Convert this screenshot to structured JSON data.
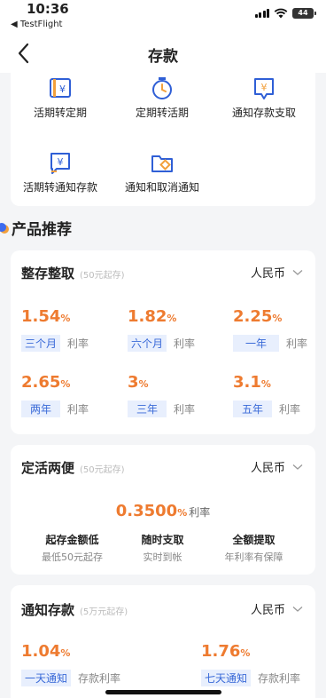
{
  "status_bar": {
    "time": "10:36",
    "back_app": "◀ TestFlight",
    "battery": "44"
  },
  "nav": {
    "title": "存款"
  },
  "services": [
    {
      "label": "活期转定期",
      "icon": "yuan-book-icon"
    },
    {
      "label": "定期转活期",
      "icon": "stopwatch-icon"
    },
    {
      "label": "通知存款支取",
      "icon": "yuan-bubble-icon"
    },
    {
      "label": "活期转通知存款",
      "icon": "yuan-message-icon"
    },
    {
      "label": "通知和取消通知",
      "icon": "folder-icon"
    }
  ],
  "section": {
    "title": "产品推荐"
  },
  "fixed": {
    "title": "整存整取",
    "subtitle": "(50元起存)",
    "currency": "人民币",
    "rates": [
      {
        "value": "1.54",
        "unit": "%",
        "term": "三个月",
        "suffix": "利率"
      },
      {
        "value": "1.82",
        "unit": "%",
        "term": "六个月",
        "suffix": "利率"
      },
      {
        "value": "2.25",
        "unit": "%",
        "term": "一年",
        "suffix": "利率"
      },
      {
        "value": "2.65",
        "unit": "%",
        "term": "两年",
        "suffix": "利率"
      },
      {
        "value": "3",
        "unit": "%",
        "term": "三年",
        "suffix": "利率"
      },
      {
        "value": "3.1",
        "unit": "%",
        "term": "五年",
        "suffix": "利率"
      }
    ]
  },
  "flex": {
    "title": "定活两便",
    "subtitle": "(50元起存)",
    "currency": "人民币",
    "rate_value": "0.3500",
    "rate_unit": "%",
    "rate_label": "利率",
    "features": [
      {
        "title": "起存金额低",
        "desc": "最低50元起存"
      },
      {
        "title": "随时支取",
        "desc": "实时到帐"
      },
      {
        "title": "全额提取",
        "desc": "年利率有保障"
      }
    ]
  },
  "notice": {
    "title": "通知存款",
    "subtitle": "(5万元起存)",
    "currency": "人民币",
    "rates": [
      {
        "value": "1.04",
        "unit": "%",
        "term": "一天通知",
        "suffix": "存款利率"
      },
      {
        "value": "1.76",
        "unit": "%",
        "term": "七天通知",
        "suffix": "存款利率"
      }
    ]
  },
  "colors": {
    "accent_orange": "#ee7b30",
    "accent_blue": "#3a6ad8",
    "tag_bg": "#e8effd"
  }
}
